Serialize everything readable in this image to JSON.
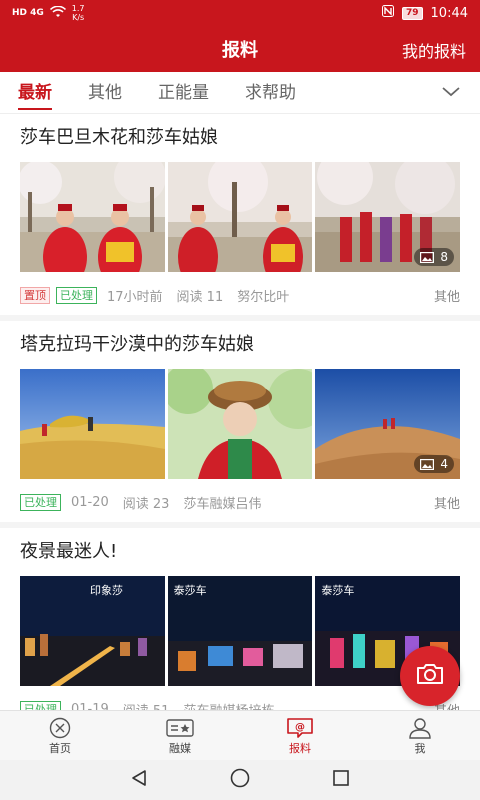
{
  "statusbar": {
    "network": "HD 4G",
    "speed_value": "1.7",
    "speed_unit": "K/s",
    "battery": "79",
    "time": "10:44"
  },
  "header": {
    "title": "报料",
    "right_link": "我的报料"
  },
  "tabs": [
    {
      "label": "最新",
      "active": true
    },
    {
      "label": "其他",
      "active": false
    },
    {
      "label": "正能量",
      "active": false
    },
    {
      "label": "求帮助",
      "active": false
    }
  ],
  "posts": [
    {
      "title": "莎车巴旦木花和莎车姑娘",
      "photo_count": "8",
      "pinned_tag": "置顶",
      "status_tag": "已处理",
      "time": "17小时前",
      "reads": "阅读 11",
      "author": "努尔比叶",
      "category": "其他"
    },
    {
      "title": "塔克拉玛干沙漠中的莎车姑娘",
      "photo_count": "4",
      "status_tag": "已处理",
      "time": "01-20",
      "reads": "阅读 23",
      "author": "莎车融媒吕伟",
      "category": "其他"
    },
    {
      "title": "夜景最迷人!",
      "status_tag": "已处理",
      "time": "01-19",
      "reads": "阅读 51",
      "author": "莎车融媒杨培栋",
      "category": "其他",
      "photo_captions": [
        "印象莎",
        "泰莎车",
        "泰莎车"
      ]
    }
  ],
  "bottom_nav": [
    {
      "label": "首页",
      "icon": "home-icon",
      "active": false
    },
    {
      "label": "融媒",
      "icon": "media-icon",
      "active": false
    },
    {
      "label": "报料",
      "icon": "report-icon",
      "active": true
    },
    {
      "label": "我",
      "icon": "profile-icon",
      "active": false
    }
  ],
  "colors": {
    "brand_red": "#c8161d",
    "processed_green": "#3cb35b"
  }
}
